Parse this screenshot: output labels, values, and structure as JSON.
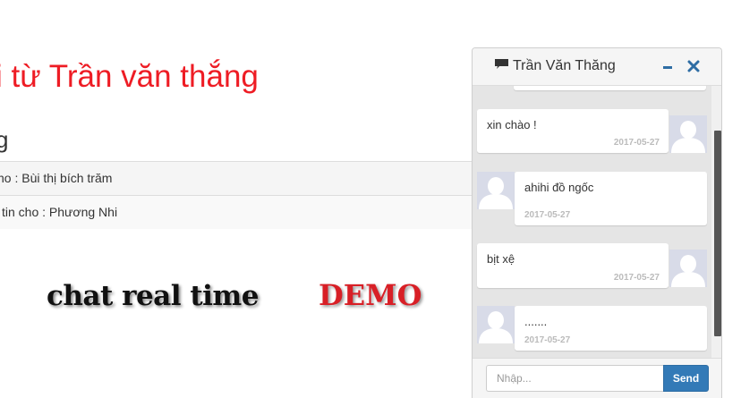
{
  "page": {
    "heading": "i từ Trần văn thắng",
    "section_heading": "g",
    "messages": [
      {
        "text": "cho : Bùi thị bích trăm"
      },
      {
        "text": "i tin cho : Phương Nhi"
      }
    ],
    "banner_chat": "chat real time",
    "banner_demo": "DEMO"
  },
  "chat": {
    "title": "Trần Văn Thăng",
    "header_icon": "comment-icon",
    "controls": [
      "minimize-icon",
      "close-icon"
    ],
    "messages": [
      {
        "text": "",
        "date": "",
        "side": "left"
      },
      {
        "text": "xin chào !",
        "date": "2017-05-27",
        "side": "right"
      },
      {
        "text": "ahihi đồ ngốc",
        "date": "2017-05-27",
        "side": "left"
      },
      {
        "text": "bịt xệ",
        "date": "2017-05-27",
        "side": "right"
      },
      {
        "text": ".......",
        "date": "2017-05-27",
        "side": "left"
      }
    ],
    "input_placeholder": "Nhập...",
    "send_label": "Send"
  },
  "colors": {
    "heading": "#ee1c24",
    "demo": "#d81f26",
    "accent": "#337ab7",
    "chat_body_bg": "#e5e5e5"
  }
}
